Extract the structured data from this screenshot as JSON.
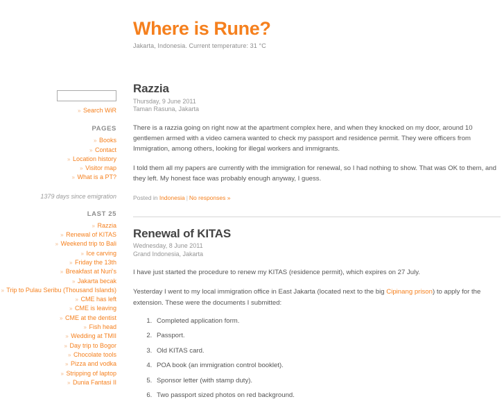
{
  "header": {
    "title": "Where is Rune?",
    "tagline": "Jakarta, Indonesia. Current temperature: 31 °C"
  },
  "colors": {
    "accent": "#F5801E",
    "text": "#555555",
    "muted": "#959595",
    "rule": "#d6d6d6"
  },
  "sidebar": {
    "search": {
      "value": "",
      "placeholder": "",
      "link_label": "Search WiR"
    },
    "pages_heading": "PAGES",
    "pages": [
      {
        "label": "Books"
      },
      {
        "label": "Contact"
      },
      {
        "label": "Location history"
      },
      {
        "label": "Visitor map"
      },
      {
        "label": "What is a PT?"
      }
    ],
    "emigration_note": "1379 days since emigration",
    "last_heading": "LAST 25",
    "last_posts": [
      {
        "label": "Razzia"
      },
      {
        "label": "Renewal of KITAS"
      },
      {
        "label": "Weekend trip to Bali"
      },
      {
        "label": "Ice carving"
      },
      {
        "label": "Friday the 13th"
      },
      {
        "label": "Breakfast at Nuri's"
      },
      {
        "label": "Jakarta becak"
      },
      {
        "label": "Trip to Pulau Seribu (Thousand Islands)"
      },
      {
        "label": "CME has left"
      },
      {
        "label": "CME is leaving"
      },
      {
        "label": "CME at the dentist"
      },
      {
        "label": "Fish head"
      },
      {
        "label": "Wedding at TMII"
      },
      {
        "label": "Day trip to Bogor"
      },
      {
        "label": "Chocolate tools"
      },
      {
        "label": "Pizza and vodka"
      },
      {
        "label": "Stripping of laptop"
      },
      {
        "label": "Dunia Fantasi II"
      }
    ],
    "bullet": "»"
  },
  "posts": [
    {
      "title": "Razzia",
      "date": "Thursday, 9 June 2011",
      "location": "Taman Rasuna, Jakarta",
      "paragraph1": "There is a razzia going on right now at the apartment complex here, and when they knocked on my door, around 10 gentlemen armed with a video camera wanted to check my passport and residence permit. They were officers from Immigration, among others, looking for illegal workers and immigrants.",
      "paragraph2": "I told them all my papers are currently with the immigration for renewal, so I had nothing to show. That was OK to them, and they left. My honest face was probably enough anyway, I guess.",
      "footer_prefix": "Posted in",
      "category": "Indonesia",
      "comments": "No responses »"
    },
    {
      "title": "Renewal of KITAS",
      "date": "Wednesday, 8 June 2011",
      "location": "Grand Indonesia, Jakarta",
      "paragraph1": "I have just started the procedure to renew my KITAS (residence permit), which expires on 27 July.",
      "paragraph2_before": "Yesterday I went to my local immigration office in East Jakarta (located next to the big ",
      "paragraph2_link": "Cipinang prison",
      "paragraph2_after": ") to apply for the extension. These were the documents I submitted:",
      "documents": [
        {
          "text": "Completed application form."
        },
        {
          "text": "Passport."
        },
        {
          "text": "Old KITAS card."
        },
        {
          "text": "POA book (an immigration control booklet)."
        },
        {
          "text": "Sponsor letter (with stamp duty)."
        },
        {
          "text": "Two passport sized photos on red background."
        }
      ]
    }
  ]
}
